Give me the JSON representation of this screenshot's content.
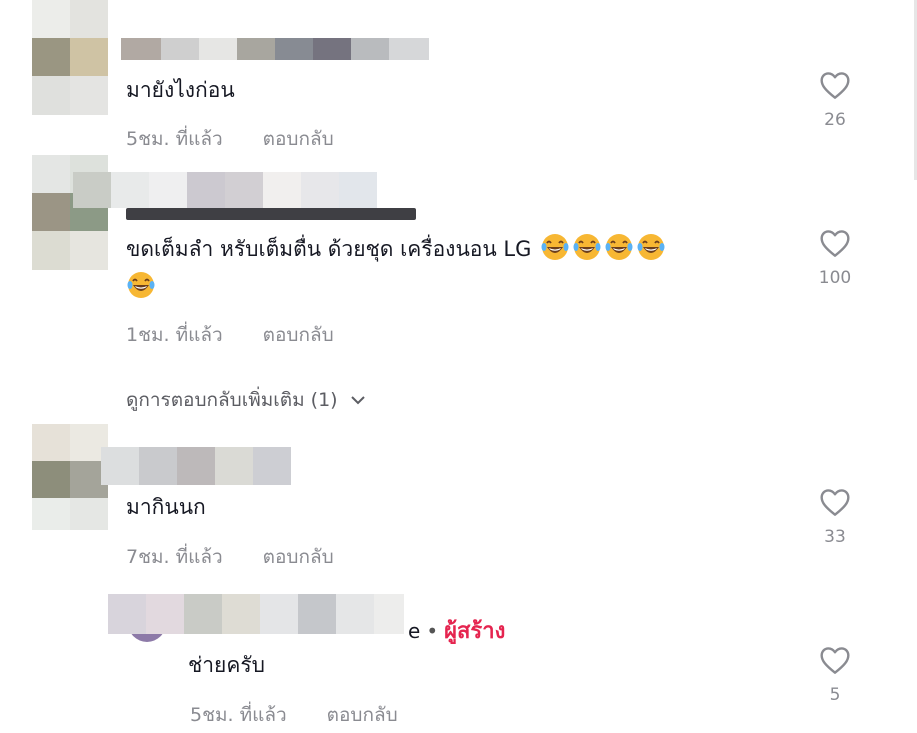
{
  "comments": [
    {
      "text": "มายังไงก่อน",
      "time": "5ชม. ที่แล้ว",
      "reply_label": "ตอบกลับ",
      "likes": "26"
    },
    {
      "text": "ขดเต็มลำ หรับเต็มตื่น ด้วยชุด เครื่องนอน LG",
      "emoji": [
        "laughing-tears-emoji",
        "laughing-tears-emoji",
        "laughing-tears-emoji",
        "laughing-tears-emoji",
        "laughing-tears-emoji"
      ],
      "time": "1ชม. ที่แล้ว",
      "reply_label": "ตอบกลับ",
      "likes": "100",
      "view_more_replies": "ดูการตอบกลับเพิ่มเติม (1)"
    },
    {
      "text": "มากินนก",
      "time": "7ชม. ที่แล้ว",
      "reply_label": "ตอบกลับ",
      "likes": "33"
    }
  ],
  "reply": {
    "name_visible_suffix": "e",
    "creator_badge": "ผู้สร้าง",
    "text": "ช่ายครับ",
    "time": "5ชม. ที่แล้ว",
    "reply_label": "ตอบกลับ",
    "likes": "5"
  },
  "colors": {
    "text": "#161823",
    "meta": "#8a8b91",
    "creator": "#e5244f",
    "emoji_face": "#f7b733"
  },
  "icons": [
    "heart-outline-icon",
    "chevron-down-icon",
    "laughing-tears-emoji"
  ]
}
